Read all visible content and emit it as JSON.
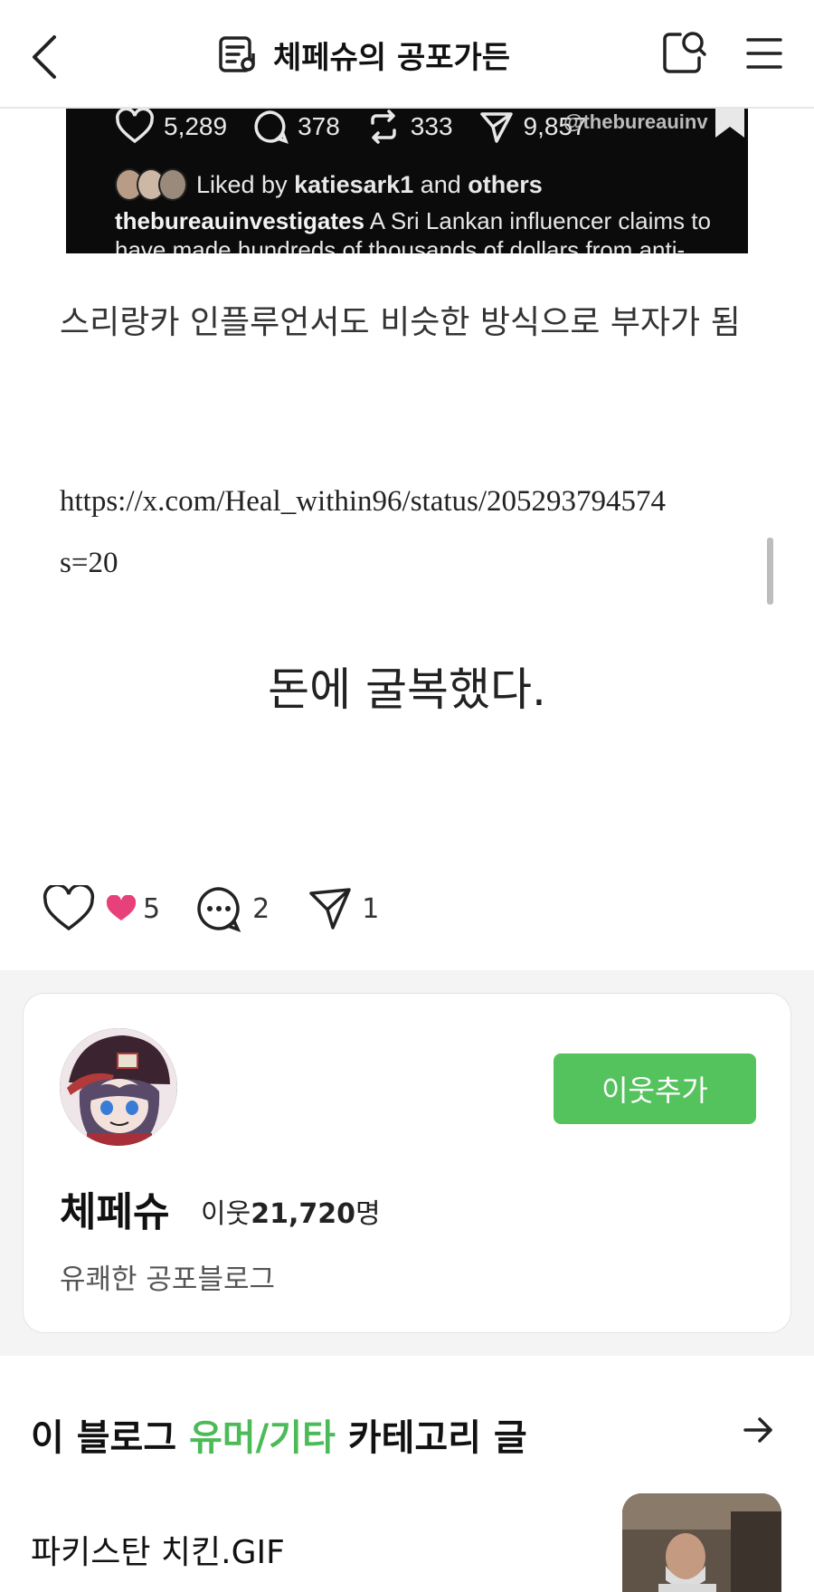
{
  "header": {
    "title": "체페슈의 공포가든",
    "icons": {
      "back": "chevron-left-icon",
      "blog": "blog-list-icon",
      "search": "search-icon",
      "menu": "menu-icon"
    }
  },
  "embed": {
    "likes": "5,289",
    "comments": "378",
    "reposts": "333",
    "shares": "9,857",
    "handle_watermark": "@thebureauinv",
    "liked_by_prefix": "Liked by ",
    "liked_by_user": "katiesark1",
    "liked_by_mid": " and ",
    "liked_by_others": "others",
    "caption_user": "thebureauinvestigates",
    "caption_line1": " A Sri Lankan influencer claims to",
    "caption_line2": "have made hundreds of thousands of dollars from anti-"
  },
  "body": {
    "paragraph": "스리랑카 인플루언서도 비슷한 방식으로 부자가 됨",
    "url_line1": "https://x.com/Heal_within96/status/205293794574",
    "url_line2": "s=20",
    "centered_text": "돈에 굴복했다."
  },
  "reactions": {
    "like_count": "5",
    "comment_count": "2",
    "share_count": "1"
  },
  "profile": {
    "name": "체페슈",
    "neighbors_label": "이웃",
    "neighbors_count": "21,720",
    "neighbors_suffix": "명",
    "description": "유쾌한 공포블로그",
    "add_button": "이웃추가"
  },
  "category": {
    "prefix": "이 블로그 ",
    "name": "유머/기타",
    "suffix": " 카테고리 글",
    "post_title": "파키스탄 치킨.GIF"
  },
  "colors": {
    "accent_green": "#55c35d",
    "heart_pink": "#e8407a"
  }
}
